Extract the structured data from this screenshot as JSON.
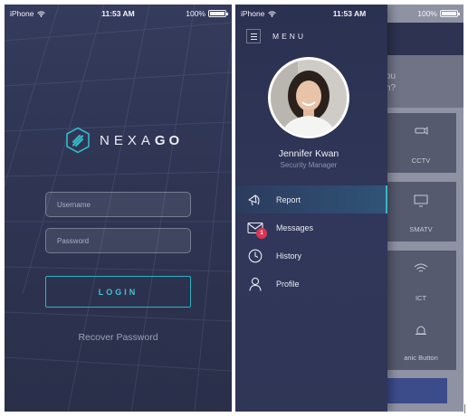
{
  "login_screen": {
    "status": {
      "carrier": "iPhone",
      "time": "11:53 AM",
      "battery": "100%"
    },
    "brand": {
      "prefix": "NEXA",
      "suffix": "GO"
    },
    "username": {
      "placeholder": "Username",
      "value": ""
    },
    "password": {
      "placeholder": "Password",
      "value": ""
    },
    "login_label": "LOGIN",
    "recover_label": "Recover Password",
    "colors": {
      "accent": "#2bb3c5",
      "background": "#2f3553"
    }
  },
  "menu_screen": {
    "status": {
      "carrier": "iPhone",
      "time": "11:53 AM",
      "battery": "100%"
    },
    "menu_title": "MENU",
    "profile": {
      "name": "Jennifer Kwan",
      "role": "Security Manager"
    },
    "items": [
      {
        "label": "Report",
        "icon": "megaphone-icon",
        "active": true
      },
      {
        "label": "Messages",
        "icon": "envelope-icon",
        "badge": "1"
      },
      {
        "label": "History",
        "icon": "clock-icon"
      },
      {
        "label": "Profile",
        "icon": "person-icon"
      }
    ],
    "background_app": {
      "banner_text_1": "ou",
      "banner_text_2": "h?",
      "tiles": [
        "CCTV",
        "SMATV",
        "ICT",
        "anic Button"
      ]
    },
    "colors": {
      "badge": "#e0334d",
      "active_highlight": "#2f5376"
    }
  }
}
